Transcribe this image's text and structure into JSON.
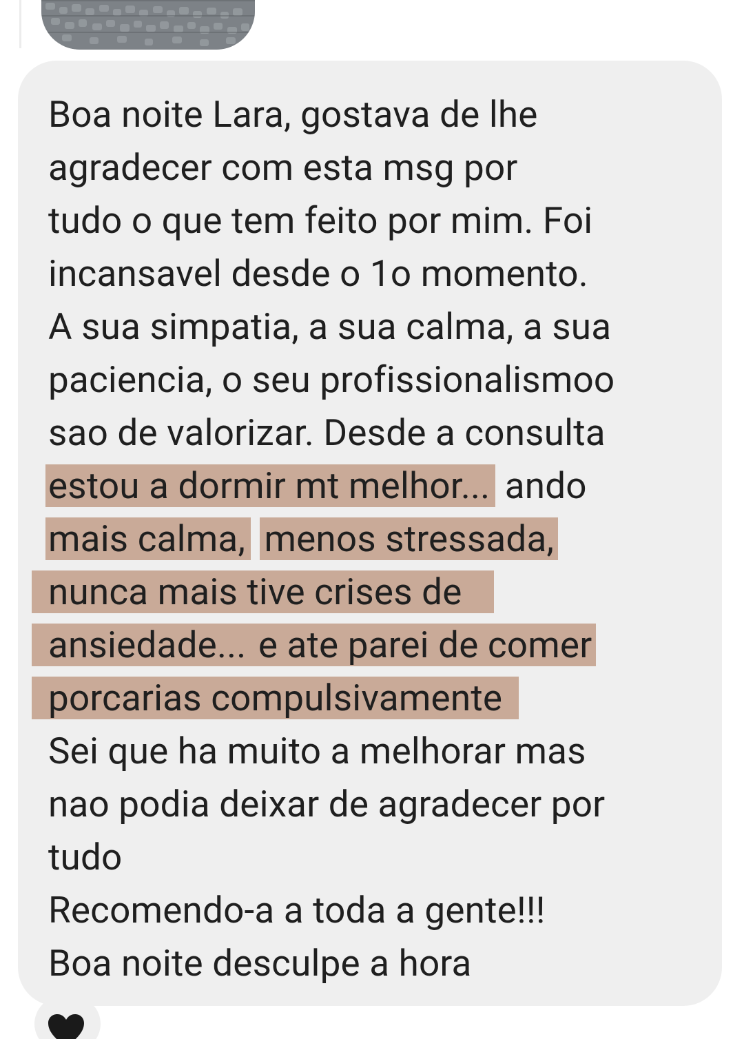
{
  "message": {
    "line_1": "Boa noite Lara, gostava de lhe",
    "line_2": "agradecer com esta msg por",
    "line_3": "tudo o que tem feito por mim. Foi",
    "line_4": "incansavel desde o 1o momento.",
    "line_5": "A sua simpatia, a sua calma, a sua",
    "line_6": "paciencia, o seu profissionalismoo",
    "line_7": "sao de valorizar. Desde a consulta",
    "line_8_highlight": "estou a dormir mt melhor...",
    "line_8_rest": " ando",
    "line_9_highlight_a": "mais calma,",
    "line_9_highlight_b": "menos stressada,",
    "line_10_highlight": "nunca mais tive crises de",
    "line_11_highlight_a": "ansiedade...",
    "line_11_highlight_b": " e ate parei de comer",
    "line_12_highlight": "porcarias compulsivamente",
    "line_13": "Sei que ha muito a melhorar mas",
    "line_14": "nao podia deixar de agradecer por",
    "line_15": "tudo",
    "line_16": "Recomendo-a a toda a gente!!!",
    "line_17": "Boa noite desculpe a hora"
  },
  "reaction": {
    "icon": "black-heart-icon"
  },
  "colors": {
    "bubble_background": "#efefef",
    "highlight": "#c9aa98",
    "text": "#1f1f1f"
  }
}
